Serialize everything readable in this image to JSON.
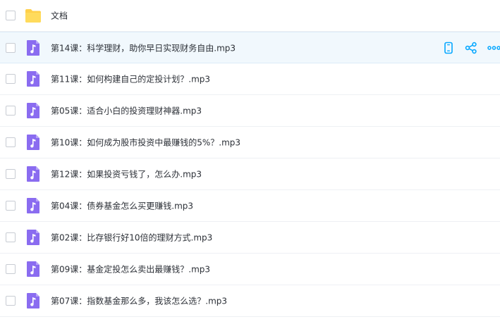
{
  "files": [
    {
      "name": "文档",
      "type": "folder-icon"
    },
    {
      "name": "第14课：科学理财，助你早日实现财务自由.mp3",
      "type": "audio-file-icon",
      "selected": true
    },
    {
      "name": "第11课：如何构建自己的定投计划？.mp3",
      "type": "audio-file-icon"
    },
    {
      "name": "第05课：适合小白的投资理财神器.mp3",
      "type": "audio-file-icon"
    },
    {
      "name": "第10课：如何成为股市投资中最赚钱的5%？.mp3",
      "type": "audio-file-icon"
    },
    {
      "name": "第12课：如果投资亏钱了，怎么办.mp3",
      "type": "audio-file-icon"
    },
    {
      "name": "第04课：债券基金怎么买更赚钱.mp3",
      "type": "audio-file-icon"
    },
    {
      "name": "第02课：比存银行好10倍的理财方式.mp3",
      "type": "audio-file-icon"
    },
    {
      "name": "第09课：基金定投怎么卖出最赚钱？.mp3",
      "type": "audio-file-icon"
    },
    {
      "name": "第07课：指数基金那么多，我该怎么选？.mp3",
      "type": "audio-file-icon"
    }
  ],
  "row_actions": [
    "phone-icon",
    "share-icon",
    "more-icon"
  ],
  "colors": {
    "accent": "#06a7ff",
    "folder": "#ffd04a",
    "audio": "#8a6cf0",
    "selected_bg": "#f1f8fd"
  }
}
